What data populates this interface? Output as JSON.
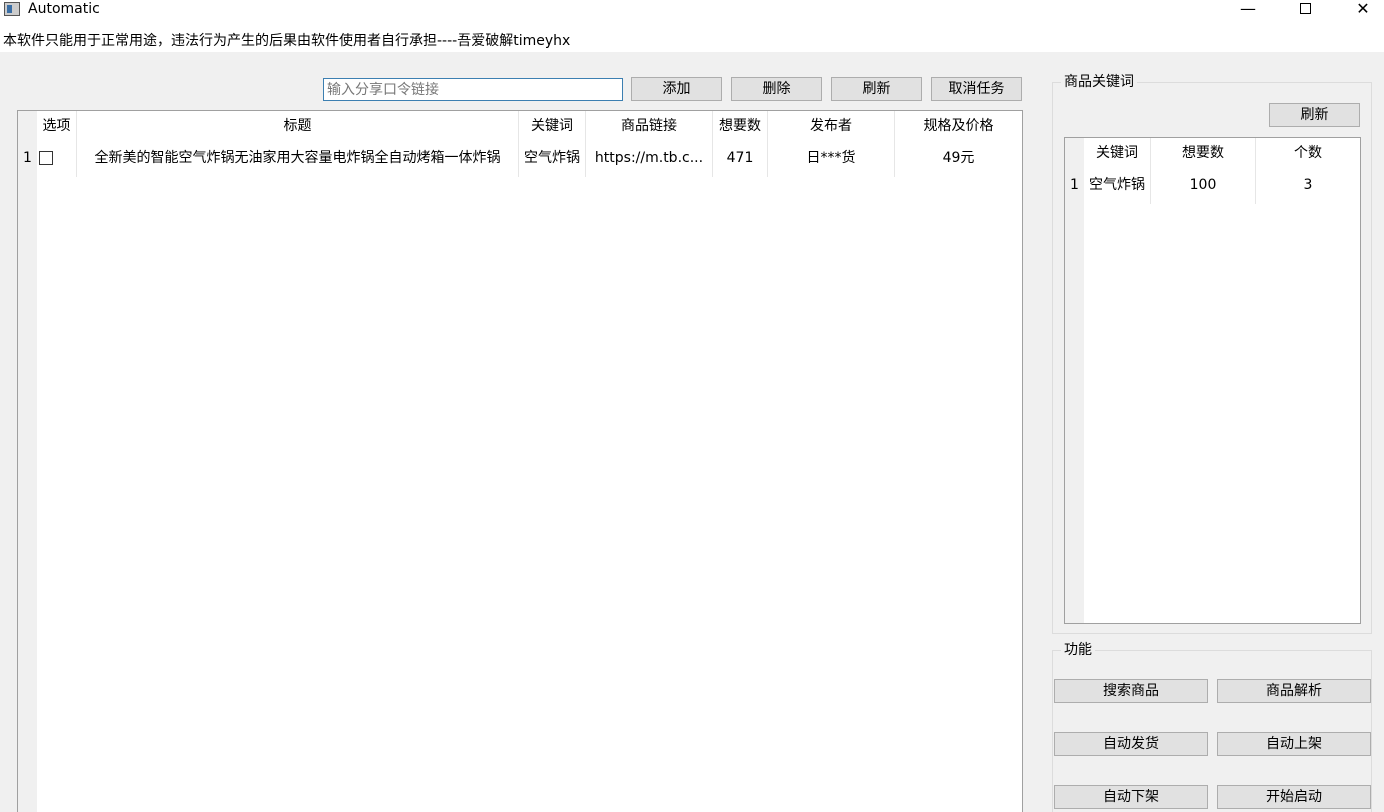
{
  "window": {
    "title": "Automatic",
    "minimize_glyph": "—",
    "close_glyph": "✕"
  },
  "notice": "本软件只能用于正常用途，违法行为产生的后果由软件使用者自行承担----吾爱破解timeyhx",
  "toolbar": {
    "link_placeholder": "输入分享口令链接",
    "add_label": "添加",
    "delete_label": "删除",
    "refresh_label": "刷新",
    "cancel_label": "取消任务"
  },
  "goods_table": {
    "headers": {
      "select": "选项",
      "title": "标题",
      "keyword": "关键词",
      "link": "商品链接",
      "want": "想要数",
      "publisher": "发布者",
      "spec_price": "规格及价格"
    },
    "rows": [
      {
        "index": "1",
        "checked": false,
        "title": "全新美的智能空气炸锅无油家用大容量电炸锅全自动烤箱一体炸锅",
        "keyword": "空气炸锅",
        "link": "https://m.tb.c...",
        "want": "471",
        "publisher": "日***货",
        "spec_price": "49元"
      }
    ]
  },
  "keyword_panel": {
    "title": "商品关键词",
    "refresh_label": "刷新",
    "headers": {
      "keyword": "关键词",
      "want": "想要数",
      "count": "个数"
    },
    "rows": [
      {
        "index": "1",
        "keyword": "空气炸锅",
        "want": "100",
        "count": "3"
      }
    ]
  },
  "function_panel": {
    "title": "功能",
    "search_label": "搜索商品",
    "parse_label": "商品解析",
    "ship_label": "自动发货",
    "list_label": "自动上架",
    "delist_label": "自动下架",
    "start_label": "开始启动"
  },
  "colors": {
    "input_border": "#3c7fb1",
    "button_bg": "#e1e1e1",
    "window_bg": "#f0f0f0"
  }
}
